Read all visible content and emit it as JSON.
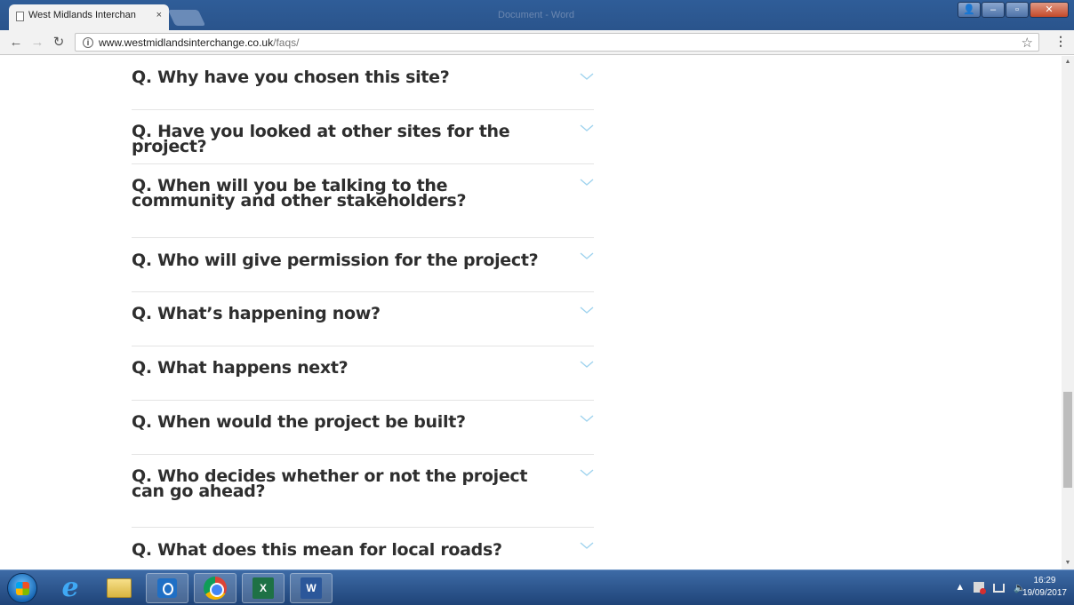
{
  "browser": {
    "tab_title": "West Midlands Interchan",
    "tab_close": "×",
    "window_caption": "Document - Word",
    "url_domain": "www.westmidlandsinterchange.co.uk",
    "url_path": "/faqs/"
  },
  "faqs": [
    {
      "question": "Q. Why have you chosen this site?"
    },
    {
      "question": "Q. Have you looked at other sites for the project?"
    },
    {
      "question": "Q. When will you be talking to the community and other stakeholders?"
    },
    {
      "question": "Q. Who will give permission for the project?"
    },
    {
      "question": "Q. What’s happening now?"
    },
    {
      "question": "Q. What happens next?"
    },
    {
      "question": "Q. When would the project be built?"
    },
    {
      "question": "Q. Who decides whether or not the project can go ahead?"
    },
    {
      "question": "Q. What does this mean for local roads?"
    }
  ],
  "taskbar": {
    "clock_time": "16:29",
    "clock_date": "19/09/2017",
    "apps": [
      "internet-explorer",
      "file-explorer",
      "outlook",
      "chrome",
      "excel",
      "word"
    ],
    "excel_label": "X",
    "word_label": "W"
  },
  "colors": {
    "accent_chevron": "#9fd3ee",
    "question_text": "#2e2e2e",
    "divider": "#e4e4e4"
  }
}
